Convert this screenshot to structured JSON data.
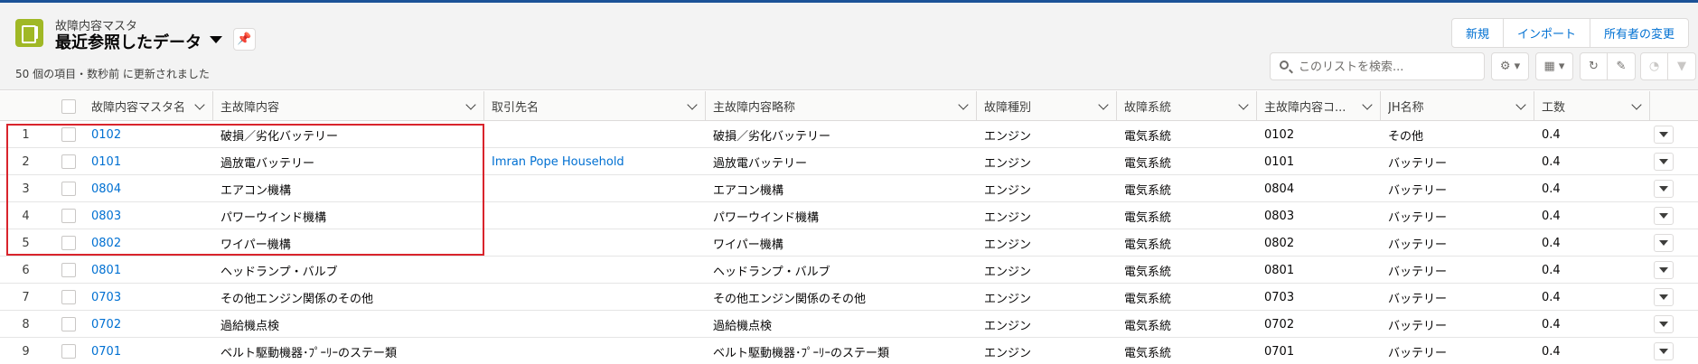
{
  "header": {
    "object_label": "故障内容マスタ",
    "list_view_title": "最近参照したデータ",
    "status_text": "50 個の項目・数秒前 に更新されました",
    "pin_icon": "pin-icon"
  },
  "actions": {
    "new_label": "新規",
    "import_label": "インポート",
    "change_owner_label": "所有者の変更"
  },
  "search": {
    "placeholder": "このリストを検索..."
  },
  "toolbar_icons": [
    "gear-icon",
    "table-icon",
    "refresh-icon",
    "pencil-icon",
    "chart-icon",
    "filter-icon"
  ],
  "columns": [
    {
      "label": "故障内容マスタ名"
    },
    {
      "label": "主故障内容"
    },
    {
      "label": "取引先名"
    },
    {
      "label": "主故障内容略称"
    },
    {
      "label": "故障種別"
    },
    {
      "label": "故障系統"
    },
    {
      "label": "主故障内容コ..."
    },
    {
      "label": "JH名称"
    },
    {
      "label": "工数"
    }
  ],
  "rows": [
    {
      "num": "1",
      "name": "0102",
      "main": "破損／劣化バッテリー",
      "account": "",
      "abbr": "破損／劣化バッテリー",
      "type": "エンジン",
      "system": "電気系統",
      "code": "0102",
      "jh": "その他",
      "hours": "0.4"
    },
    {
      "num": "2",
      "name": "0101",
      "main": "過放電バッテリー",
      "account": "Imran Pope Household",
      "abbr": "過放電バッテリー",
      "type": "エンジン",
      "system": "電気系統",
      "code": "0101",
      "jh": "バッテリー",
      "hours": "0.4"
    },
    {
      "num": "3",
      "name": "0804",
      "main": "エアコン機構",
      "account": "",
      "abbr": "エアコン機構",
      "type": "エンジン",
      "system": "電気系統",
      "code": "0804",
      "jh": "バッテリー",
      "hours": "0.4"
    },
    {
      "num": "4",
      "name": "0803",
      "main": "パワーウインド機構",
      "account": "",
      "abbr": "パワーウインド機構",
      "type": "エンジン",
      "system": "電気系統",
      "code": "0803",
      "jh": "バッテリー",
      "hours": "0.4"
    },
    {
      "num": "5",
      "name": "0802",
      "main": "ワイパー機構",
      "account": "",
      "abbr": "ワイパー機構",
      "type": "エンジン",
      "system": "電気系統",
      "code": "0802",
      "jh": "バッテリー",
      "hours": "0.4"
    },
    {
      "num": "6",
      "name": "0801",
      "main": "ヘッドランプ・バルブ",
      "account": "",
      "abbr": "ヘッドランプ・バルブ",
      "type": "エンジン",
      "system": "電気系統",
      "code": "0801",
      "jh": "バッテリー",
      "hours": "0.4"
    },
    {
      "num": "7",
      "name": "0703",
      "main": "その他エンジン関係のその他",
      "account": "",
      "abbr": "その他エンジン関係のその他",
      "type": "エンジン",
      "system": "電気系統",
      "code": "0703",
      "jh": "バッテリー",
      "hours": "0.4"
    },
    {
      "num": "8",
      "name": "0702",
      "main": "過給機点検",
      "account": "",
      "abbr": "過給機点検",
      "type": "エンジン",
      "system": "電気系統",
      "code": "0702",
      "jh": "バッテリー",
      "hours": "0.4"
    },
    {
      "num": "9",
      "name": "0701",
      "main": "ベルト駆動機器･ﾌﾟｰﾘｰのステー類",
      "account": "",
      "abbr": "ベルト駆動機器･ﾌﾟｰﾘｰのステー類",
      "type": "エンジン",
      "system": "電気系統",
      "code": "0701",
      "jh": "バッテリー",
      "hours": "0.4"
    }
  ],
  "colors": {
    "brand_bar": "#1b5297",
    "object_icon": "#a0b825",
    "link": "#0070d2",
    "highlight_box": "#d9242c"
  }
}
